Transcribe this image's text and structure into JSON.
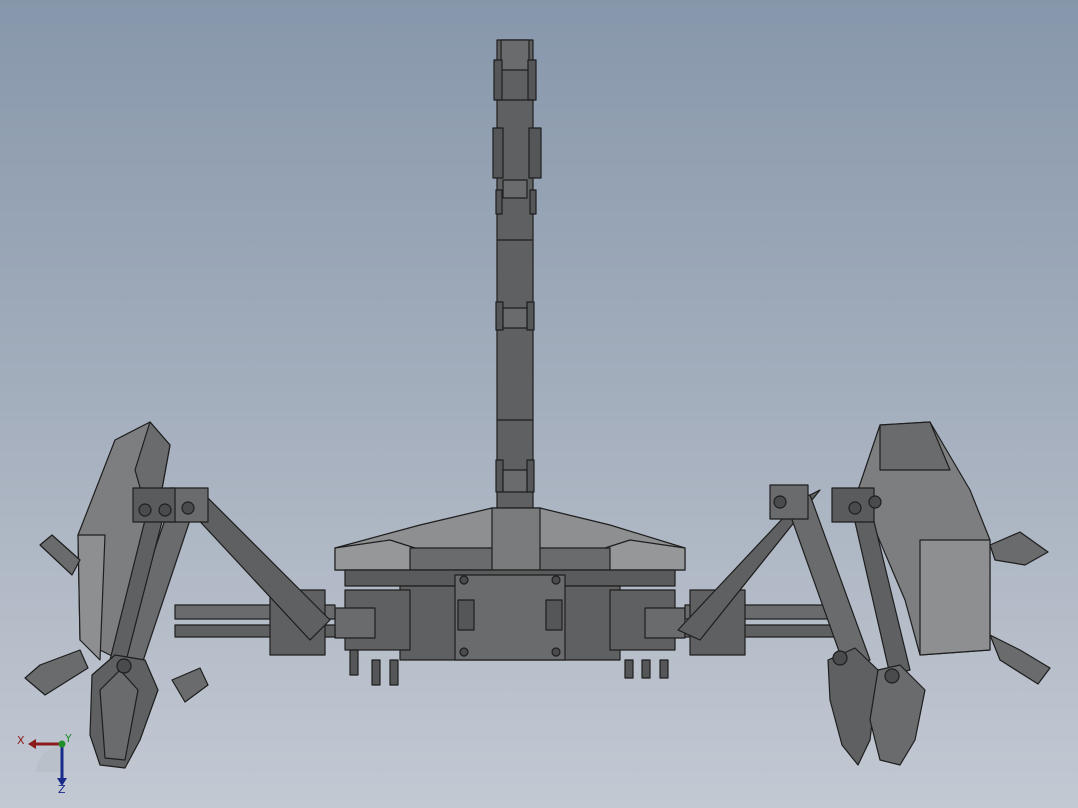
{
  "viewport": {
    "background_top": "#8797ab",
    "background_bottom": "#c3c9d3",
    "model_fill": "#5f6062",
    "model_fill_light": "#7a7b7d",
    "model_edge": "#1e1e1e"
  },
  "triad": {
    "x_label": "X",
    "y_label": "Y",
    "z_label": "Z",
    "x_color": "#8b1a1a",
    "y_color": "#1f8f2a",
    "z_color": "#1a2a8b"
  }
}
